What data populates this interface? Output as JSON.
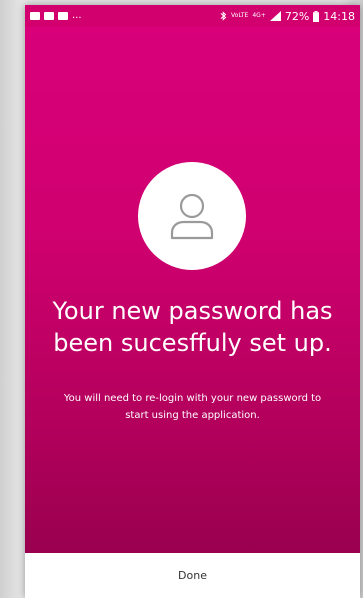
{
  "status_bar": {
    "notification_icons": [
      "image-icon",
      "mail-icon",
      "gmail-icon"
    ],
    "overflow": "...",
    "network_label": "VoLTE",
    "signal_label": "4G+",
    "battery": "72%",
    "time": "14:18"
  },
  "hero": {
    "avatar_icon": "user-icon",
    "headline_line1": "Your new password has",
    "headline_line2": "been sucesffuly set up.",
    "subtext_line1": "You will need to re-login with your new password to",
    "subtext_line2": "start using the application."
  },
  "footer": {
    "done_label": "Done"
  },
  "colors": {
    "accent": "#d2006e",
    "gradient_bottom": "#9a004f",
    "text_on_accent": "#ffffff"
  }
}
